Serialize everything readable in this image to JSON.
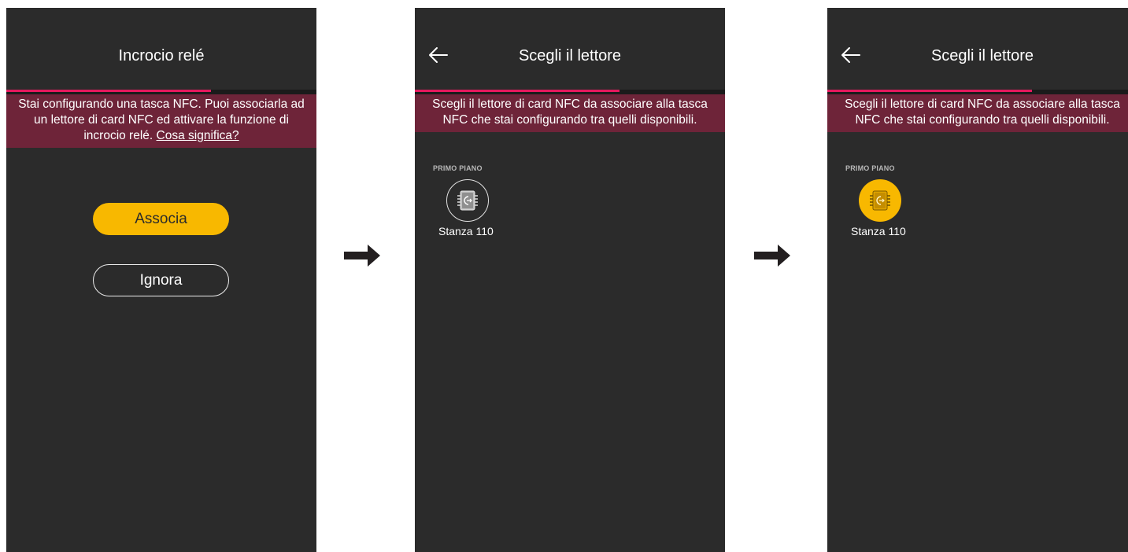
{
  "screen1": {
    "title": "Incrocio relé",
    "progress": 0.66,
    "banner_text": "Stai configurando una tasca NFC. Puoi associarla ad un lettore di card NFC ed attivare la funzione di incrocio relé.",
    "banner_link": "Cosa significa?",
    "primary_button": "Associa",
    "secondary_button": "Ignora"
  },
  "screen2": {
    "title": "Scegli il lettore",
    "progress": 0.66,
    "banner_text": "Scegli il lettore di card NFC da associare alla tasca NFC che stai configurando tra quelli disponibili.",
    "group_label": "PRIMO PIANO",
    "device_label": "Stanza 110",
    "device_icon": "nfc-reader-icon",
    "selected": false
  },
  "screen3": {
    "title": "Scegli il lettore",
    "progress": 0.66,
    "banner_text": "Scegli il lettore di card NFC da associare alla tasca NFC che stai configurando tra quelli disponibili.",
    "group_label": "PRIMO PIANO",
    "device_label": "Stanza 110",
    "device_icon": "nfc-reader-icon",
    "selected": true
  },
  "colors": {
    "background": "#2b2b2b",
    "accent": "#e5195e",
    "banner": "#6e2439",
    "primary": "#f8b800",
    "arrow": "#231f20"
  }
}
